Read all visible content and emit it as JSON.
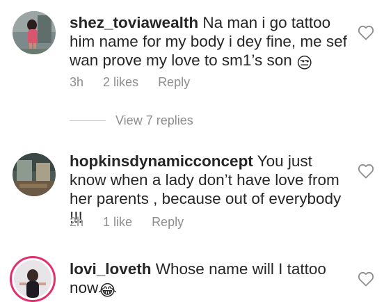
{
  "comments": [
    {
      "username": "shez_toviawealth",
      "text": " Na man i go tattoo him name for my body i dey fine, me sef wan prove my love to sm1’s son ",
      "emoji": "😒",
      "time": "3h",
      "likes": "2 likes",
      "reply": "Reply",
      "avatar_icon": "avatar-icon",
      "like_icon": "heart-icon"
    },
    {
      "username": "hopkinsdynamicconcept",
      "text": " You just know when a lady don’t have love from her parents , because out of everybody !!!",
      "time": "2h",
      "likes": "1 like",
      "reply": "Reply",
      "avatar_icon": "avatar-icon",
      "like_icon": "heart-icon"
    },
    {
      "username": "lovi_loveth",
      "text": " Whose name will I tattoo now",
      "emoji": "😂",
      "avatar_icon": "avatar-icon",
      "like_icon": "heart-icon"
    }
  ],
  "view_replies": "View 7 replies",
  "colors": {
    "text": "#262626",
    "meta": "#8e8e8e",
    "story_ring": "#e1306c"
  }
}
